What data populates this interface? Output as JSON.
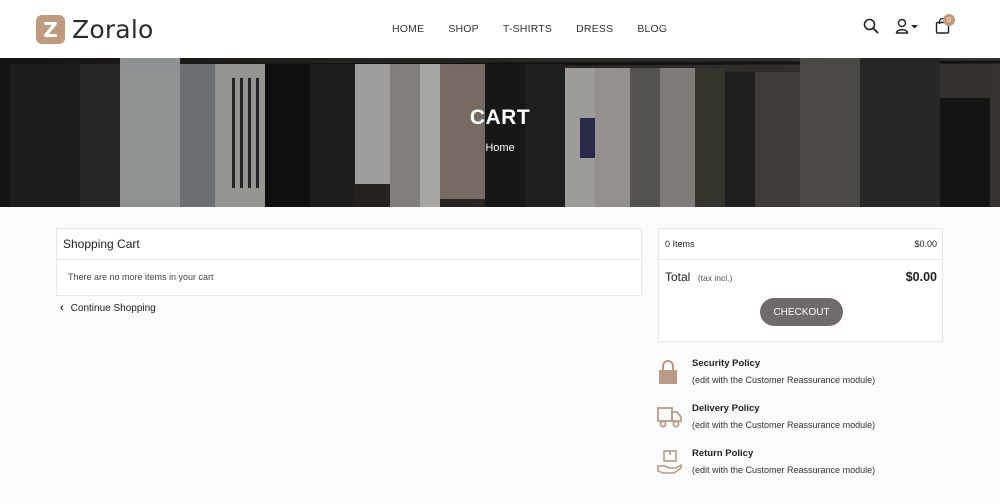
{
  "header": {
    "logo_mark": "Z",
    "logo_text": "Zoralo",
    "nav": [
      "HOME",
      "SHOP",
      "T-SHIRTS",
      "DRESS",
      "BLOG"
    ],
    "cart_count": "0",
    "icons": [
      "search-icon",
      "user-icon",
      "shopping-bag-icon"
    ]
  },
  "banner": {
    "title": "CART",
    "breadcrumb": "Home"
  },
  "cart": {
    "title": "Shopping Cart",
    "empty_message": "There are no more items in your cart",
    "continue_label": "Continue Shopping"
  },
  "summary": {
    "items_label": "0 Items",
    "items_value": "$0.00",
    "total_label": "Total",
    "total_sub": "(tax incl.)",
    "total_value": "$0.00",
    "checkout_label": "CHECKOUT"
  },
  "reassurance": [
    {
      "icon": "lock-icon",
      "title": "Security Policy",
      "desc": "(edit with the Customer Reassurance module)"
    },
    {
      "icon": "truck-icon",
      "title": "Delivery Policy",
      "desc": "(edit with the Customer Reassurance module)"
    },
    {
      "icon": "return-box-icon",
      "title": "Return Policy",
      "desc": "(edit with the Customer Reassurance module)"
    }
  ],
  "colors": {
    "accent": "#c09a7e",
    "checkout_bg": "#6e6b6a",
    "banner_bg": "#2a2724"
  }
}
